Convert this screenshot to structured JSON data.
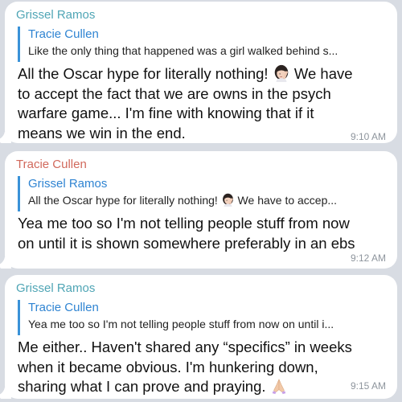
{
  "messages": [
    {
      "sender": "Grissel Ramos",
      "sender_color": "#4fa5b5",
      "reply_to": {
        "name": "Tracie Cullen",
        "text": "Like the only thing that happened was a girl walked behind s..."
      },
      "body_lines": [
        {
          "before": "All the Oscar hype for literally nothing! ",
          "emoji": "woman-facepalming-icon",
          "after": " We have"
        },
        {
          "before": "to accept the fact that we are owns in the psych",
          "emoji": "",
          "after": ""
        },
        {
          "before": "warfare game... I'm fine with knowing that if it",
          "emoji": "",
          "after": ""
        },
        {
          "before": "means we win in the end.",
          "emoji": "",
          "after": ""
        }
      ],
      "time": "9:10 AM"
    },
    {
      "sender": "Tracie Cullen",
      "sender_color": "#d1695c",
      "reply_to": {
        "name": "Grissel Ramos",
        "text_before": "All the Oscar hype for literally nothing! ",
        "emoji": "woman-facepalming-icon",
        "text_after": " We have to accep..."
      },
      "body_lines": [
        {
          "before": "Yea me too so I'm not telling people stuff from now",
          "emoji": "",
          "after": ""
        },
        {
          "before": "on until it is shown somewhere preferably in an ebs",
          "emoji": "",
          "after": ""
        }
      ],
      "time": "9:12 AM"
    },
    {
      "sender": "Grissel Ramos",
      "sender_color": "#4fa5b5",
      "reply_to": {
        "name": "Tracie Cullen",
        "text": "Yea me too so I'm not telling people stuff from now on until i..."
      },
      "body_lines": [
        {
          "before": "Me either.. Haven't shared any “specifics” in weeks",
          "emoji": "",
          "after": ""
        },
        {
          "before": "when it became obvious. I'm hunkering down,",
          "emoji": "",
          "after": ""
        },
        {
          "before": "sharing what I can prove and praying. ",
          "emoji": "folded-hands-icon",
          "after": ""
        }
      ],
      "time": "9:15 AM"
    }
  ],
  "colors": {
    "background": "#d8dce3",
    "bubble": "#ffffff",
    "reply_accent": "#3a92d8",
    "timestamp": "#8e959d"
  }
}
